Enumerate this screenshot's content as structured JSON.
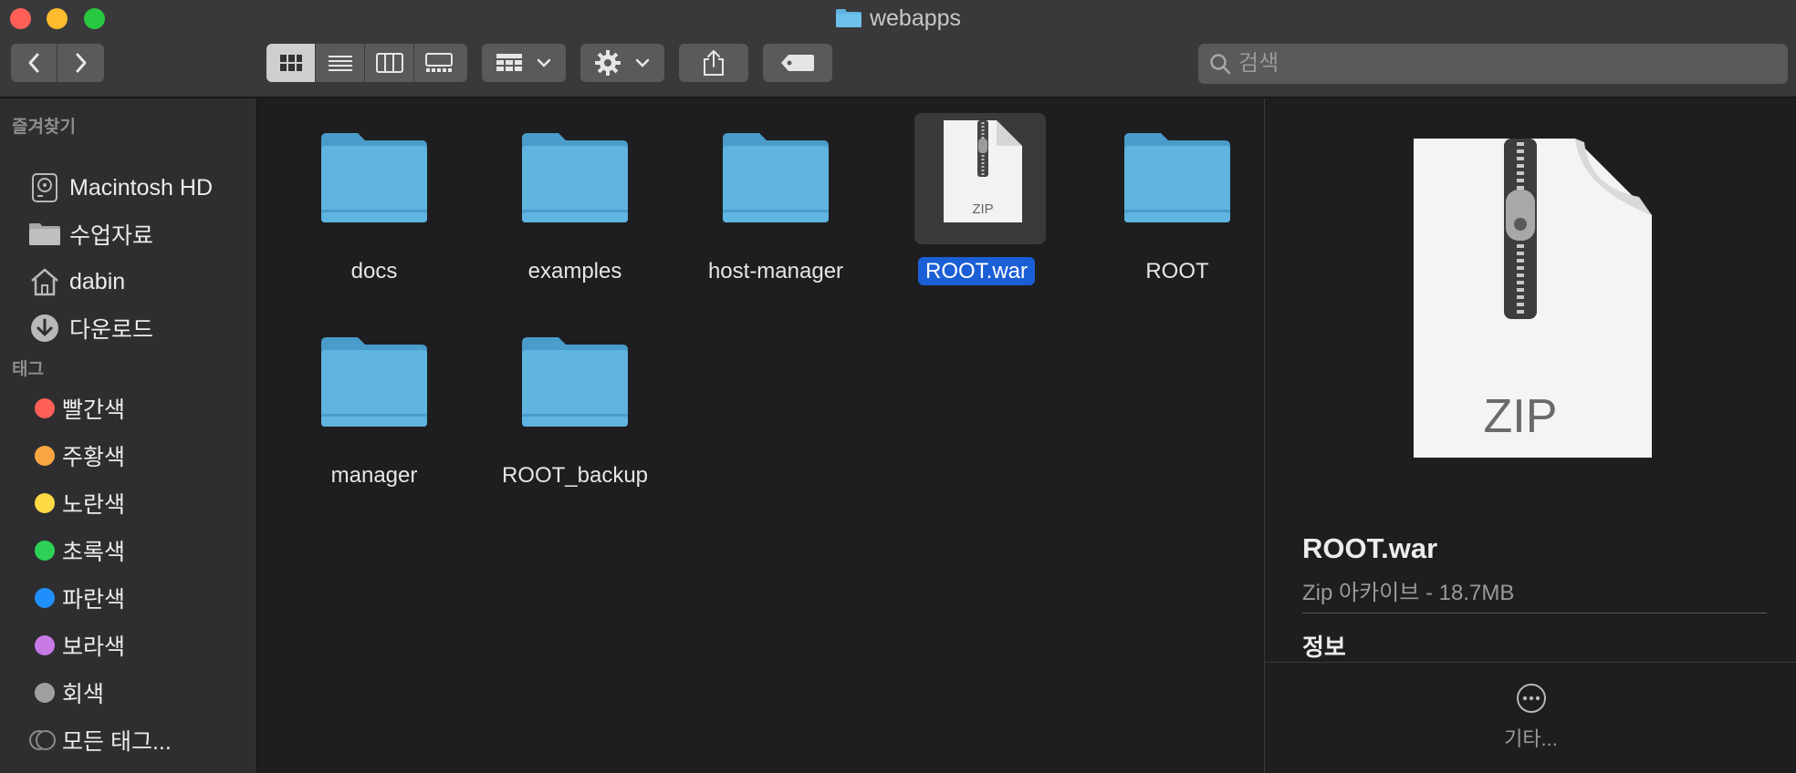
{
  "window": {
    "title": "webapps"
  },
  "toolbar": {
    "back_icon": "chevron-left-icon",
    "forward_icon": "chevron-right-icon",
    "view_modes": [
      "icon-view-icon",
      "list-view-icon",
      "column-view-icon",
      "gallery-view-icon"
    ],
    "active_view": 0,
    "group_icon": "group-grid-icon",
    "action_icon": "gear-icon",
    "share_icon": "share-icon",
    "tag_icon": "tag-icon",
    "search_placeholder": "검색"
  },
  "sidebar": {
    "favorites_heading": "즐겨찾기",
    "favorites": [
      {
        "label": "Macintosh HD",
        "icon": "hard-drive-icon"
      },
      {
        "label": "수업자료",
        "icon": "folder-icon"
      },
      {
        "label": "dabin",
        "icon": "home-icon"
      },
      {
        "label": "다운로드",
        "icon": "download-icon"
      }
    ],
    "tags_heading": "태그",
    "tags": [
      {
        "label": "빨간색",
        "color": "#fe5f57"
      },
      {
        "label": "주황색",
        "color": "#f9a541"
      },
      {
        "label": "노란색",
        "color": "#fdd945"
      },
      {
        "label": "초록색",
        "color": "#2ed158"
      },
      {
        "label": "파란색",
        "color": "#1f8ffc"
      },
      {
        "label": "보라색",
        "color": "#c77ae6"
      },
      {
        "label": "회색",
        "color": "#a0a0a2"
      },
      {
        "label": "모든 태그...",
        "color": "#7a7a7c"
      }
    ]
  },
  "files": [
    {
      "name": "docs",
      "type": "folder",
      "selected": false
    },
    {
      "name": "examples",
      "type": "folder",
      "selected": false
    },
    {
      "name": "host-manager",
      "type": "folder",
      "selected": false
    },
    {
      "name": "ROOT.war",
      "type": "zip",
      "badge": "ZIP",
      "selected": true
    },
    {
      "name": "ROOT",
      "type": "folder",
      "selected": false
    },
    {
      "name": "manager",
      "type": "folder",
      "selected": false
    },
    {
      "name": "ROOT_backup",
      "type": "folder",
      "selected": false
    }
  ],
  "preview": {
    "badge": "ZIP",
    "name": "ROOT.war",
    "kind": "Zip 아카이브 - 18.7MB",
    "info_heading": "정보",
    "more_label": "기타...",
    "more_icon": "ellipsis-circle-icon"
  },
  "colors": {
    "folder": "#5fb4e0",
    "selection": "#1b5fd6"
  }
}
